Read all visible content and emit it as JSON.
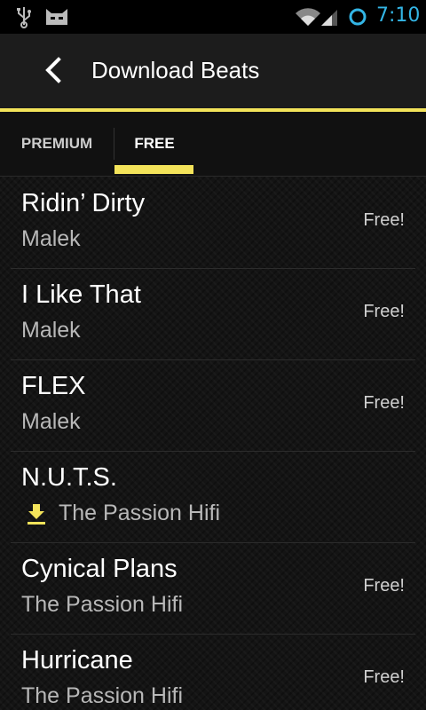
{
  "status_bar": {
    "time": "7:10",
    "icons": [
      "usb-icon",
      "cat-icon",
      "wifi-icon",
      "signal-icon",
      "battery-icon"
    ],
    "clock_color": "#33b5e5"
  },
  "action_bar": {
    "title": "Download Beats",
    "accent_color": "#f3e35a"
  },
  "tabs": [
    {
      "label": "PREMIUM",
      "selected": false
    },
    {
      "label": "FREE",
      "selected": true
    }
  ],
  "beats": [
    {
      "title": "Ridin’ Dirty",
      "artist": "Malek",
      "price": "Free!",
      "downloaded": false
    },
    {
      "title": "I Like That",
      "artist": "Malek",
      "price": "Free!",
      "downloaded": false
    },
    {
      "title": "FLEX",
      "artist": "Malek",
      "price": "Free!",
      "downloaded": false
    },
    {
      "title": "N.U.T.S.",
      "artist": "The Passion Hifi",
      "price": "",
      "downloaded": true
    },
    {
      "title": "Cynical Plans",
      "artist": "The Passion Hifi",
      "price": "Free!",
      "downloaded": false
    },
    {
      "title": "Hurricane",
      "artist": "The Passion Hifi",
      "price": "Free!",
      "downloaded": false
    }
  ]
}
